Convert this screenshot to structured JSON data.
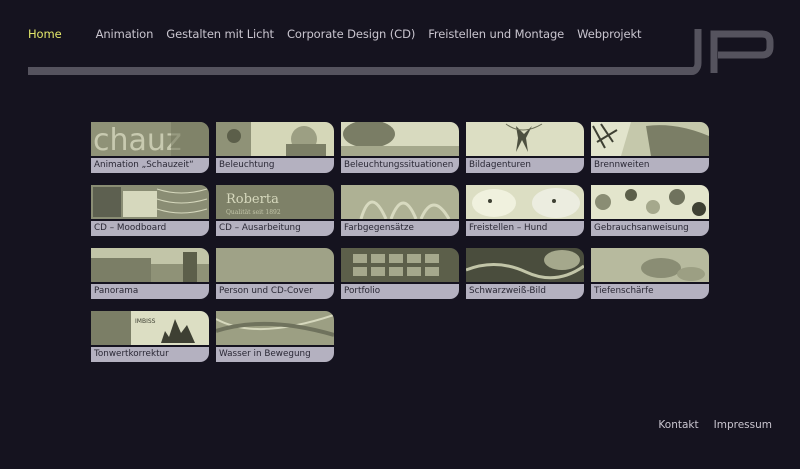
{
  "nav": {
    "items": [
      {
        "label": "Home",
        "active": true
      },
      {
        "label": "Animation"
      },
      {
        "label": "Gestalten mit Licht"
      },
      {
        "label": "Corporate Design (CD)"
      },
      {
        "label": "Freistellen und Montage"
      },
      {
        "label": "Webprojekt"
      }
    ]
  },
  "logo": {
    "icon": "jp-logo-icon"
  },
  "tiles": [
    {
      "label": "Animation „Schauzeit“",
      "thumb_text": "chauz"
    },
    {
      "label": "Beleuchtung"
    },
    {
      "label": "Beleuchtungssituationen"
    },
    {
      "label": "Bildagenturen"
    },
    {
      "label": "Brennweiten"
    },
    {
      "label": "CD – Moodboard"
    },
    {
      "label": "CD – Ausarbeitung",
      "thumb_text": "Roberta",
      "thumb_sub": "Qualität seit 1892"
    },
    {
      "label": "Farbgegensätze"
    },
    {
      "label": "Freistellen – Hund"
    },
    {
      "label": "Gebrauchsanweisung"
    },
    {
      "label": "Panorama"
    },
    {
      "label": "Person und CD-Cover"
    },
    {
      "label": "Portfolio"
    },
    {
      "label": "Schwarzweiß-Bild"
    },
    {
      "label": "Tiefenschärfe"
    },
    {
      "label": "Tonwertkorrektur",
      "thumb_text": "IMBISS"
    },
    {
      "label": "Wasser in Bewegung"
    }
  ],
  "footer": {
    "kontakt": "Kontakt",
    "impressum": "Impressum"
  },
  "colors": {
    "background": "#15131f",
    "active_nav": "#e3e86a",
    "thumb_tint": "#bfc29e",
    "label_bg": "#b4b1c0"
  }
}
